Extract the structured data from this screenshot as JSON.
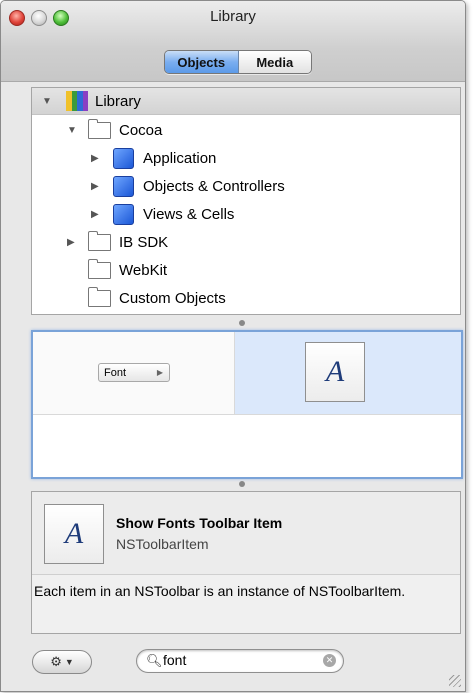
{
  "window": {
    "title": "Library"
  },
  "segments": [
    {
      "label": "Objects",
      "selected": true
    },
    {
      "label": "Media",
      "selected": false
    }
  ],
  "outline": {
    "items": [
      {
        "label": "Library",
        "icon": "library-books-icon",
        "expanded": true
      },
      {
        "label": "Cocoa",
        "icon": "folder-icon",
        "expanded": true
      },
      {
        "label": "Application",
        "icon": "blue-cube-icon",
        "expanded": false
      },
      {
        "label": "Objects & Controllers",
        "icon": "blue-cube-icon",
        "expanded": false
      },
      {
        "label": "Views & Cells",
        "icon": "blue-cube-icon",
        "expanded": false
      },
      {
        "label": "IB SDK",
        "icon": "folder-icon",
        "expanded": false
      },
      {
        "label": "WebKit",
        "icon": "folder-icon"
      },
      {
        "label": "Custom Objects",
        "icon": "folder-icon"
      }
    ]
  },
  "preview": {
    "items": [
      {
        "label": "Font",
        "kind": "popup-button"
      },
      {
        "glyph": "A",
        "kind": "font-icon",
        "selected": true
      }
    ]
  },
  "detail": {
    "icon_glyph": "A",
    "title": "Show Fonts Toolbar Item",
    "subtitle": "NSToolbarItem",
    "description": "Each item in an NSToolbar is an instance of NSToolbarItem."
  },
  "search": {
    "value": "font"
  },
  "colors": {
    "segment_selected": "#5c9ae8",
    "preview_selection": "#dbe8fb",
    "preview_border": "#7aa3d8"
  }
}
